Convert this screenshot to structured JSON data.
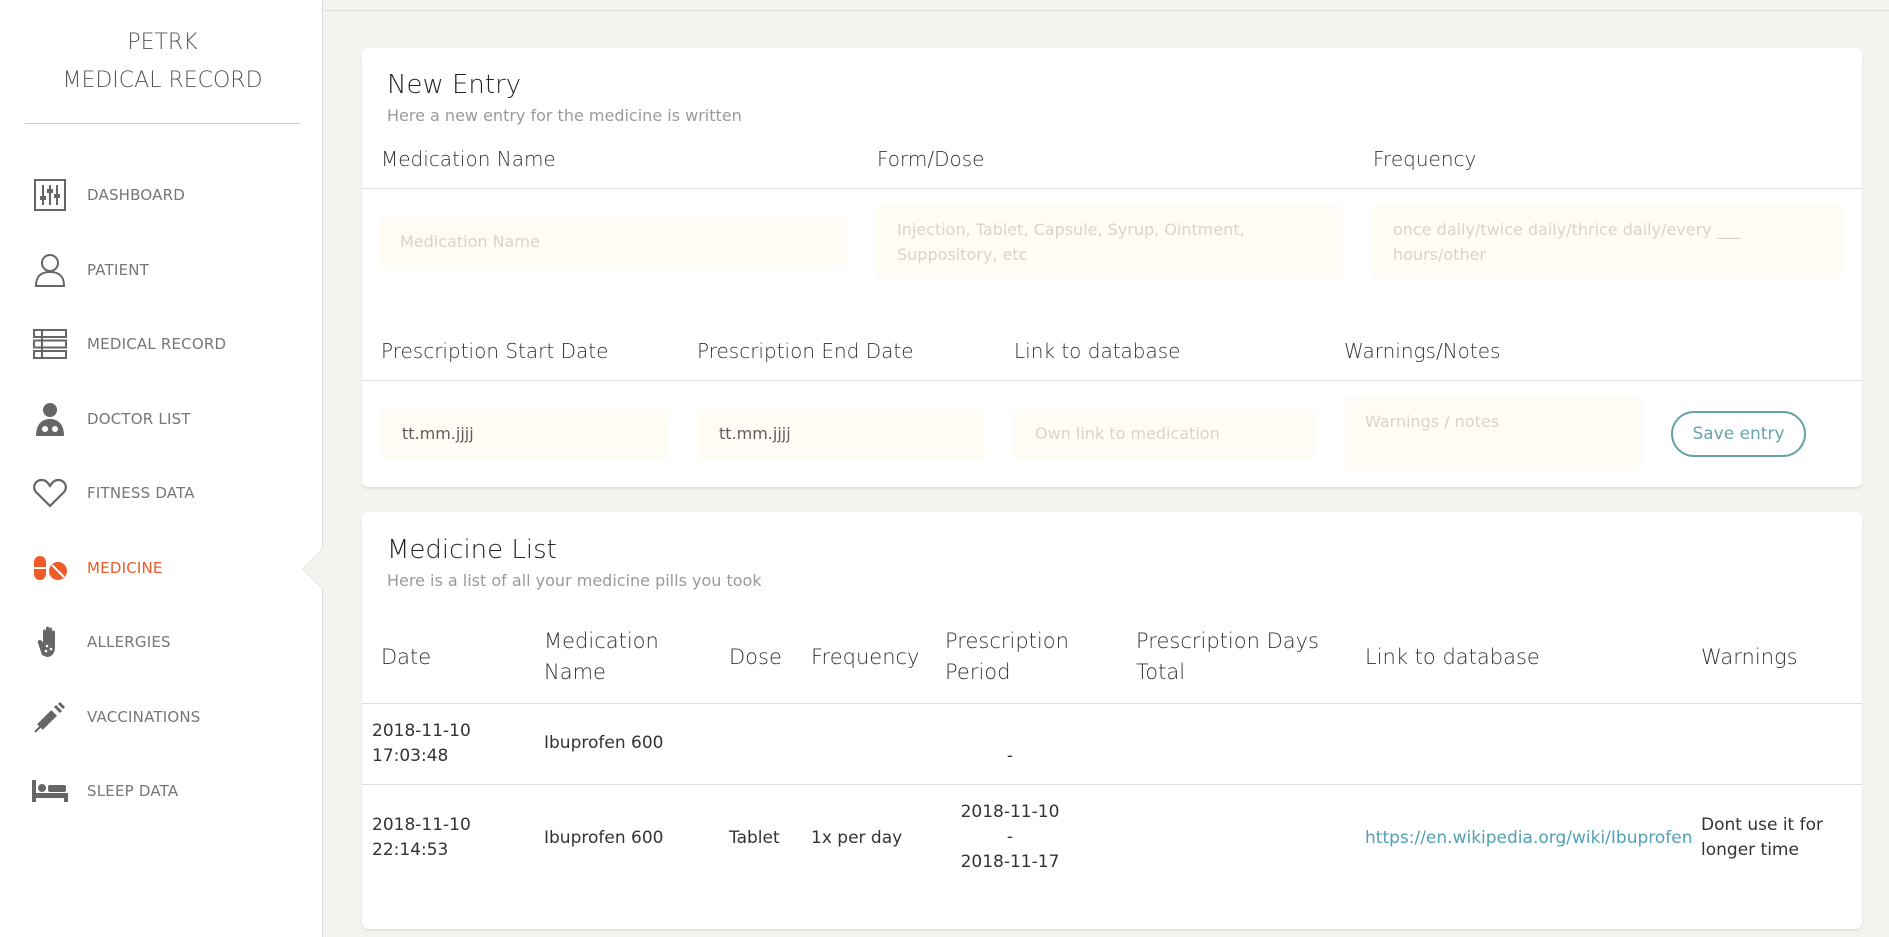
{
  "brand": {
    "line1": "PETRK",
    "line2": "MEDICAL RECORD"
  },
  "sidebar": {
    "items": [
      {
        "label": "DASHBOARD",
        "icon": "sliders-icon"
      },
      {
        "label": "PATIENT",
        "icon": "user-icon"
      },
      {
        "label": "MEDICAL RECORD",
        "icon": "list-icon"
      },
      {
        "label": "DOCTOR LIST",
        "icon": "doctor-icon"
      },
      {
        "label": "FITNESS DATA",
        "icon": "heart-icon"
      },
      {
        "label": "MEDICINE",
        "icon": "pills-icon",
        "active": true
      },
      {
        "label": "ALLERGIES",
        "icon": "hand-icon"
      },
      {
        "label": "VACCINATIONS",
        "icon": "syringe-icon"
      },
      {
        "label": "SLEEP DATA",
        "icon": "bed-icon"
      }
    ],
    "active_color": "#ee5a28"
  },
  "new_entry": {
    "title": "New Entry",
    "subtitle": "Here a new entry for the medicine is written",
    "headers": {
      "medication_name": "Medication Name",
      "form_dose": "Form/Dose",
      "frequency": "Frequency",
      "start_date": "Prescription Start Date",
      "end_date": "Prescription End Date",
      "link": "Link to database",
      "warnings": "Warnings/Notes"
    },
    "placeholders": {
      "medication_name": "Medication Name",
      "form_dose": "Injection, Tablet, Capsule, Syrup, Ointment, Suppository, etc",
      "frequency": "once daily/twice daily/thrice daily/every ___ hours/other",
      "start_date": "tt.mm.jjjj",
      "end_date": "tt.mm.jjjj",
      "link": "Own link to medication",
      "warnings": "Warnings / notes"
    },
    "save_label": "Save entry"
  },
  "medicine_list": {
    "title": "Medicine List",
    "subtitle": "Here is a list of all your medicine pills you took",
    "columns": {
      "date": "Date",
      "name_1": "Medication",
      "name_2": "Name",
      "dose": "Dose",
      "frequency": "Frequency",
      "period_1": "Prescription",
      "period_2": "Period",
      "days_1": "Prescription Days",
      "days_2": "Total",
      "link": "Link to database",
      "warnings": "Warnings"
    },
    "rows": [
      {
        "date_1": "2018-11-10",
        "date_2": "17:03:48",
        "name": "Ibuprofen 600",
        "dose": "",
        "frequency": "",
        "period_1": "",
        "period_2": "-",
        "period_3": "",
        "days": "",
        "link": "",
        "warnings_1": "",
        "warnings_2": ""
      },
      {
        "date_1": "2018-11-10",
        "date_2": "22:14:53",
        "name": "Ibuprofen 600",
        "dose": "Tablet",
        "frequency": "1x per day",
        "period_1": "2018-11-10",
        "period_2": "-",
        "period_3": "2018-11-17",
        "days": "",
        "link": "https://en.wikipedia.org/wiki/Ibuprofen",
        "warnings_1": "Dont use it for",
        "warnings_2": "longer time"
      }
    ]
  }
}
